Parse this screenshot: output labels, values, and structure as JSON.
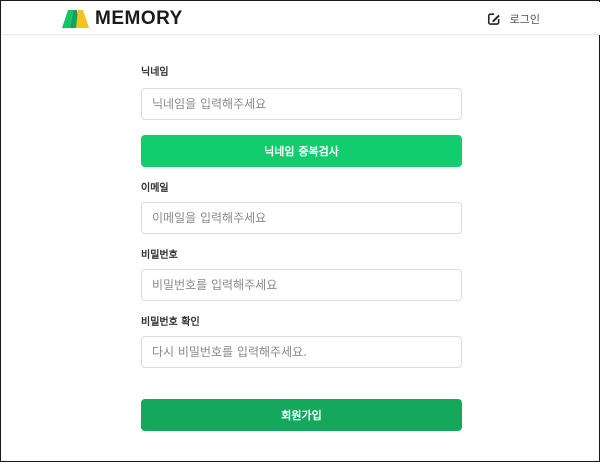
{
  "header": {
    "logo_text": "MEMORY",
    "login_label": "로그인",
    "logo_colors": {
      "left": "#12c46a",
      "right": "#f4c21b"
    }
  },
  "form": {
    "nickname": {
      "label": "닉네임",
      "placeholder": "닉네임을 입력해주세요"
    },
    "nickname_check_button": "닉네임 중복검사",
    "email": {
      "label": "이메일",
      "placeholder": "이메일을 입력해주세요"
    },
    "password": {
      "label": "비밀번호",
      "placeholder": "비밀번호를 입력해주세요"
    },
    "password_confirm": {
      "label": "비밀번호 확인",
      "placeholder": "다시 비밀번호를 입력해주세요."
    },
    "signup_button": "회원가입"
  },
  "icons": {
    "login": "edit-icon"
  },
  "colors": {
    "check_button": "#12cd6e",
    "signup_button": "#13a85b"
  }
}
